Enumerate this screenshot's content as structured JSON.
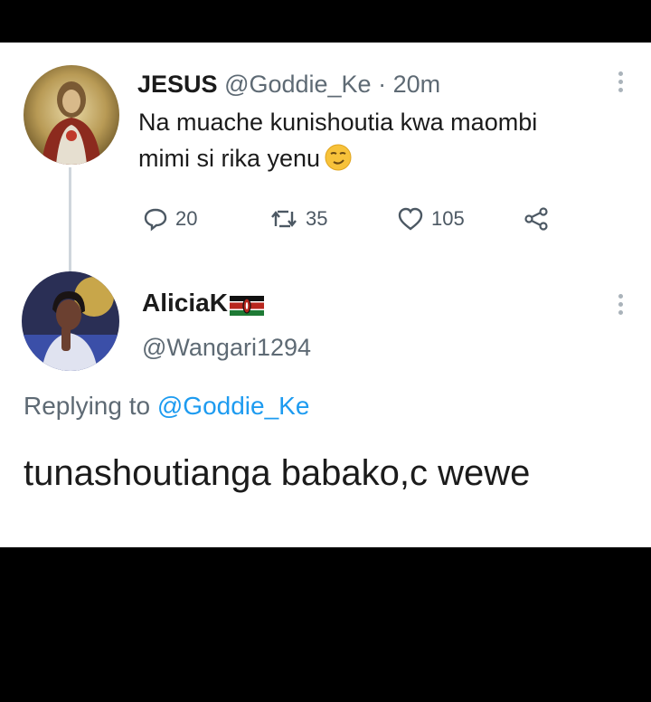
{
  "tweet": {
    "author_name": "JESUS",
    "handle": "@Goddie_Ke",
    "separator": "·",
    "time": "20m",
    "body": "Na muache kunishoutia kwa maombi mimi si rika yenu",
    "emoji": "smirking-face-icon",
    "counts": {
      "replies": "20",
      "retweets": "35",
      "likes": "105"
    }
  },
  "reply": {
    "author_name": "AliciaK",
    "flag": "kenya-flag-icon",
    "handle": "@Wangari1294",
    "replying_label": "Replying to",
    "replying_to": "@Goddie_Ke",
    "body": "tunashoutianga babako,c wewe"
  },
  "colors": {
    "background": "#000000",
    "card": "#ffffff",
    "link": "#1d9bf0",
    "muted": "#5e6a74"
  }
}
